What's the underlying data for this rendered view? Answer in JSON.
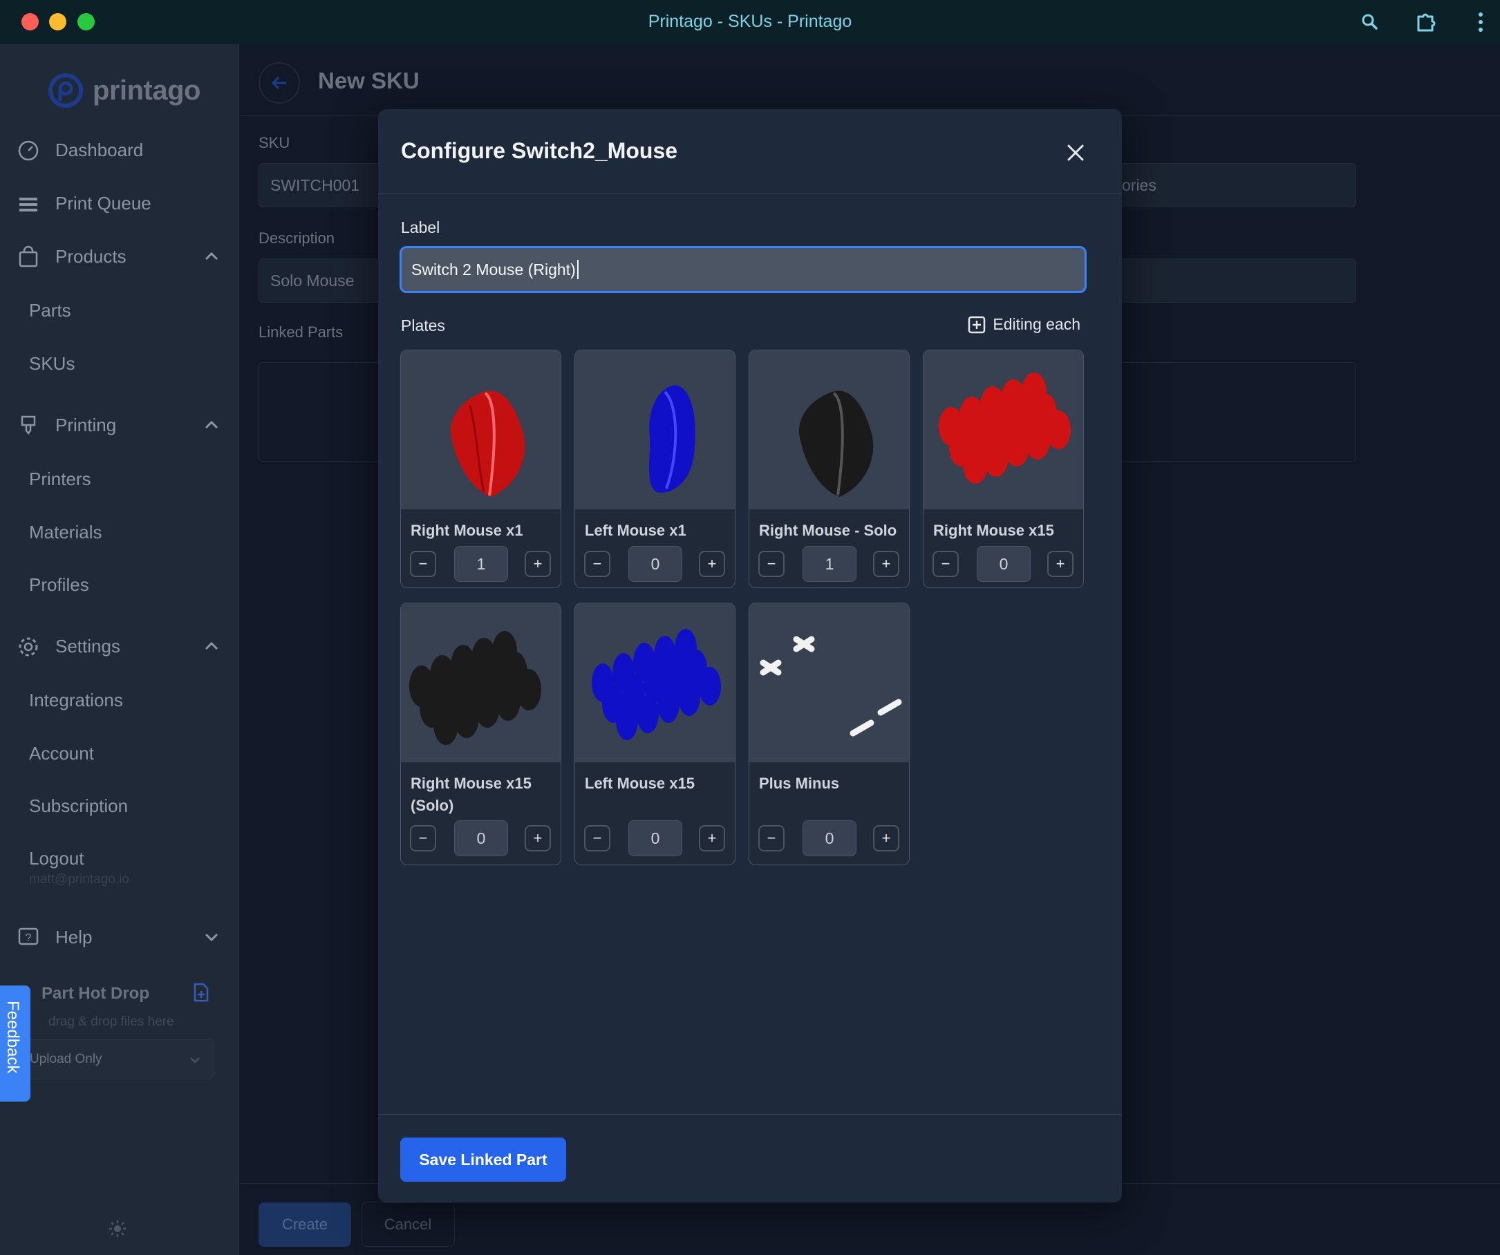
{
  "window": {
    "title": "Printago - SKUs - Printago"
  },
  "sidebar": {
    "logo_text": "printago",
    "nav": {
      "dashboard": "Dashboard",
      "print_queue": "Print Queue",
      "products": "Products",
      "parts": "Parts",
      "skus": "SKUs",
      "printing": "Printing",
      "printers": "Printers",
      "materials": "Materials",
      "profiles": "Profiles",
      "settings": "Settings",
      "integrations": "Integrations",
      "account": "Account",
      "subscription": "Subscription",
      "logout": "Logout",
      "user_email": "matt@printago.io",
      "help": "Help"
    },
    "hot_drop": {
      "title": "Part Hot Drop",
      "hint": "drag & drop files here",
      "mode": "Upload Only"
    },
    "feedback": "Feedback"
  },
  "page": {
    "title": "New SKU",
    "sku_label": "SKU",
    "sku_value": "SWITCH001",
    "right_field_fragment": "ories",
    "description_label": "Description",
    "description_value": "Solo Mouse",
    "linked_parts_label": "Linked Parts",
    "create_label": "Create",
    "cancel_label": "Cancel"
  },
  "modal": {
    "title": "Configure Switch2_Mouse",
    "label_field_label": "Label",
    "label_value": "Switch 2 Mouse (Right)",
    "plates_label": "Plates",
    "editing_each": "Editing each",
    "plates": [
      {
        "name": "Right Mouse x1",
        "qty": "1",
        "color": "#d11212"
      },
      {
        "name": "Left Mouse x1",
        "qty": "0",
        "color": "#1111cc"
      },
      {
        "name": "Right Mouse - Solo",
        "qty": "1",
        "color": "#1c1c1c"
      },
      {
        "name": "Right Mouse x15",
        "qty": "0",
        "color": "#d11212"
      },
      {
        "name": "Right Mouse x15 (Solo)",
        "qty": "0",
        "color": "#1c1c1c"
      },
      {
        "name": "Left Mouse x15",
        "qty": "0",
        "color": "#1111cc"
      },
      {
        "name": "Plus Minus",
        "qty": "0",
        "color": "#f2f2f2"
      }
    ],
    "minus": "−",
    "plus": "+",
    "save_label": "Save Linked Part"
  }
}
